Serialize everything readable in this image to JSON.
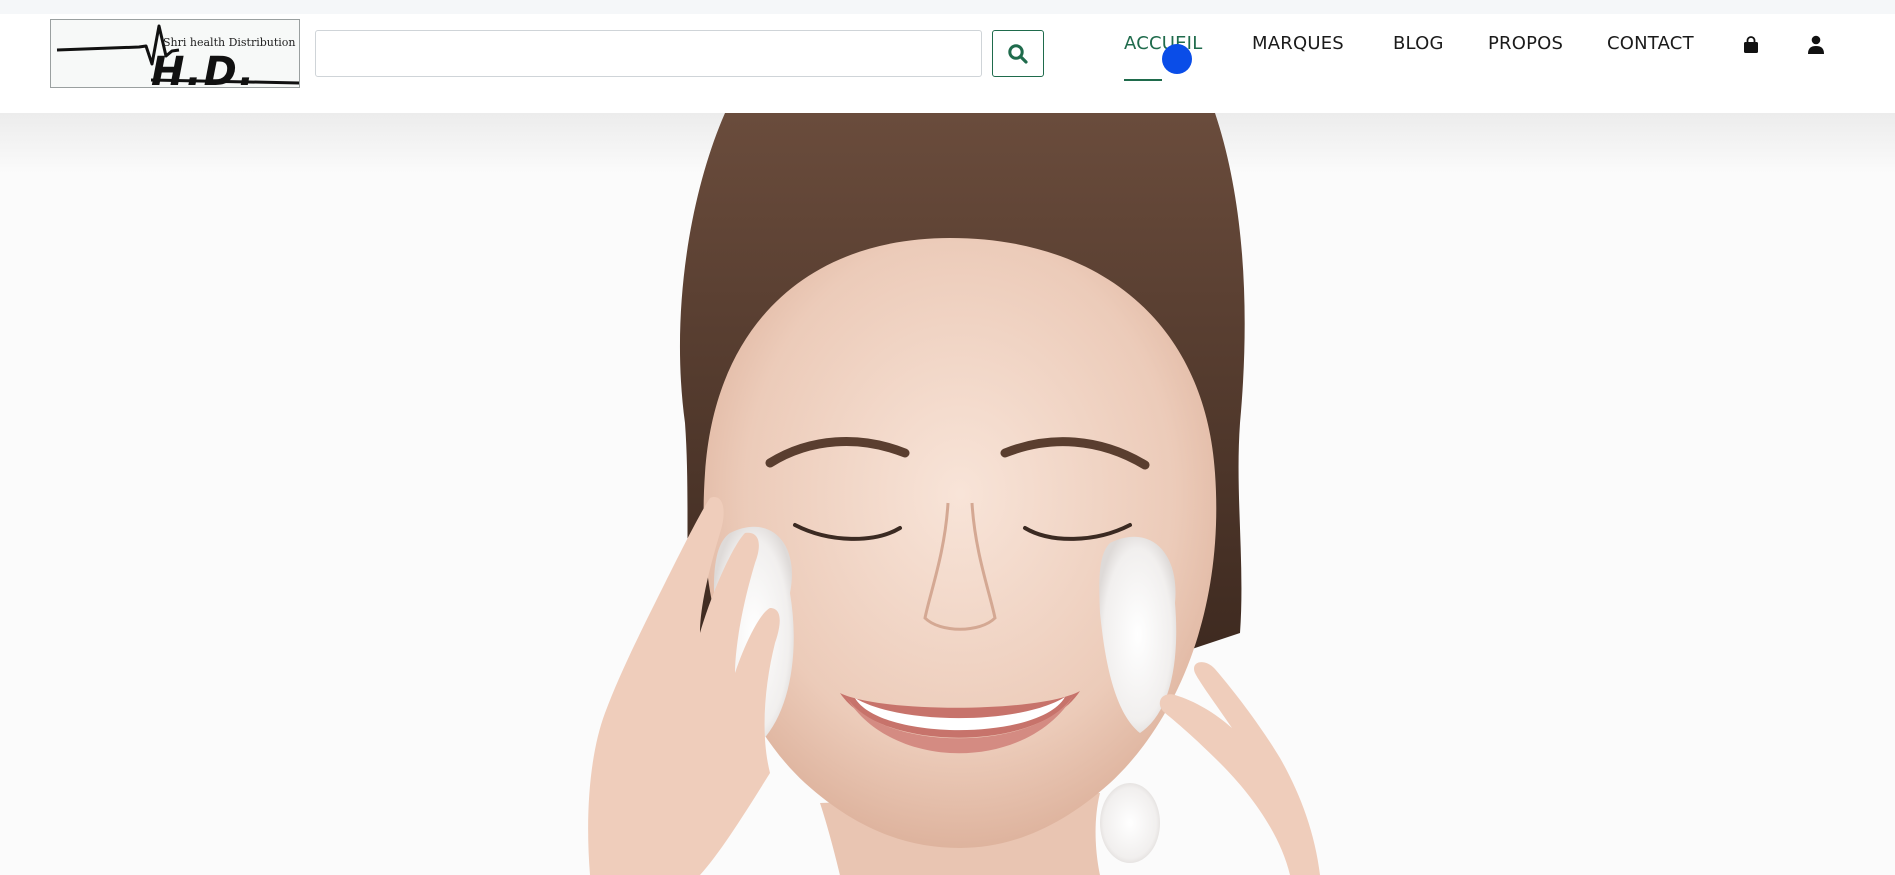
{
  "header": {
    "logo": {
      "tagline": "Shri health Distribution",
      "mark": "H.D."
    },
    "search": {
      "value": "",
      "placeholder": "",
      "button_icon": "search-icon"
    },
    "nav": {
      "items": [
        {
          "label": "ACCUEIL",
          "active": true
        },
        {
          "label": "MARQUES",
          "active": false
        },
        {
          "label": "BLOG",
          "active": false
        },
        {
          "label": "PROPOS",
          "active": false
        },
        {
          "label": "CONTACT",
          "active": false
        }
      ],
      "icons": [
        "shopping-bag-icon",
        "user-icon"
      ]
    }
  },
  "hero": {
    "image": "woman-washing-face-with-foam"
  },
  "colors": {
    "accent": "#1f6b4c",
    "cursor": "#0a4de8",
    "text": "#1b1b1b"
  }
}
